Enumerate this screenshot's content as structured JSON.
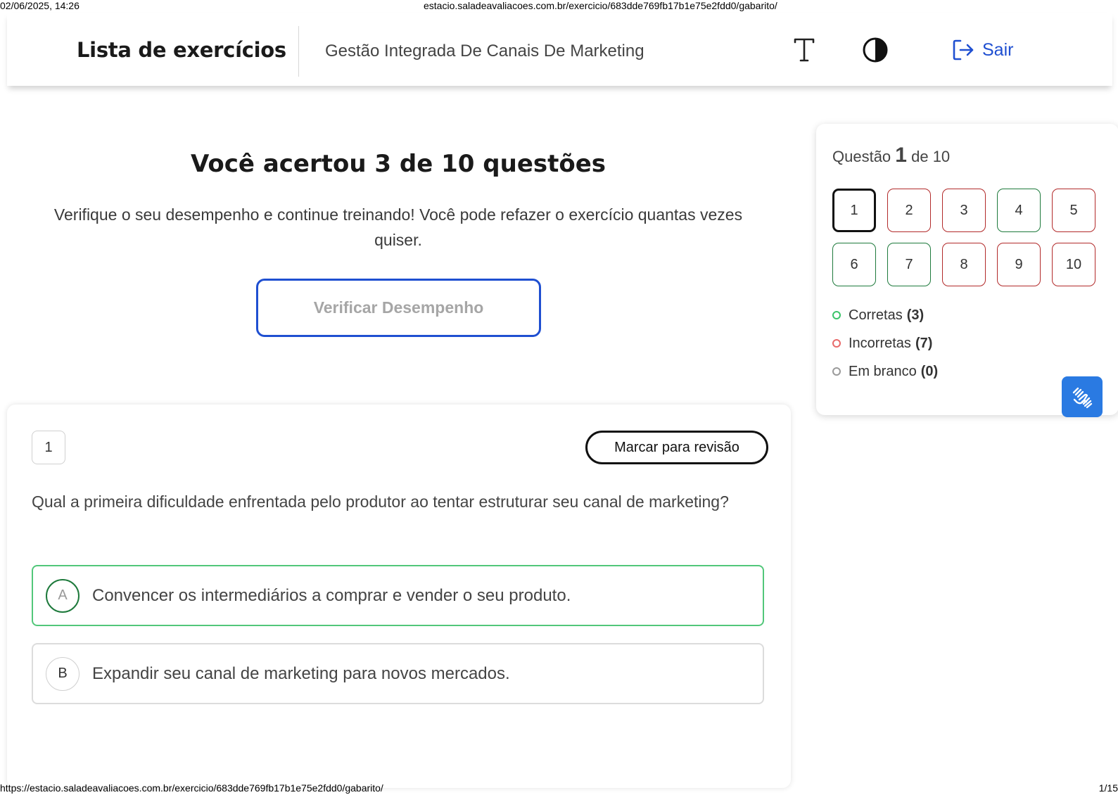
{
  "print": {
    "date": "02/06/2025, 14:26",
    "top_url": "estacio.saladeavaliacoes.com.br/exercicio/683dde769fb17b1e75e2fdd0/gabarito/",
    "bottom_url": "https://estacio.saladeavaliacoes.com.br/exercicio/683dde769fb17b1e75e2fdd0/gabarito/",
    "page": "1/15"
  },
  "header": {
    "title": "Lista de exercícios",
    "course": "Gestão Integrada De Canais De Marketing",
    "font_icon": "font-size-icon",
    "contrast_icon": "contrast-icon",
    "logout_label": "Sair",
    "accent": "#1f4fd1"
  },
  "result": {
    "title": "Você acertou 3 de 10 questões",
    "subtitle": "Verifique o seu desempenho e continue treinando! Você pode refazer o exercício quantas vezes quiser.",
    "button_label": "Verificar Desempenho"
  },
  "question": {
    "number": "1",
    "mark_label": "Marcar para revisão",
    "text": "Qual a primeira dificuldade enfrentada pelo produtor ao tentar estruturar seu canal de marketing?",
    "options": [
      {
        "letter": "A",
        "text": "Convencer os intermediários a comprar e vender o seu produto.",
        "state": "correct"
      },
      {
        "letter": "B",
        "text": "Expandir seu canal de marketing para novos mercados.",
        "state": "neutral"
      }
    ]
  },
  "navigator": {
    "prefix": "Questão",
    "current": "1",
    "suffix": "de 10",
    "cells": [
      {
        "label": "1",
        "status": "current"
      },
      {
        "label": "2",
        "status": "incorrect"
      },
      {
        "label": "3",
        "status": "incorrect"
      },
      {
        "label": "4",
        "status": "correct"
      },
      {
        "label": "5",
        "status": "incorrect"
      },
      {
        "label": "6",
        "status": "correct"
      },
      {
        "label": "7",
        "status": "correct"
      },
      {
        "label": "8",
        "status": "incorrect"
      },
      {
        "label": "9",
        "status": "incorrect"
      },
      {
        "label": "10",
        "status": "incorrect"
      }
    ],
    "legend": [
      {
        "label": "Corretas",
        "count": "(3)",
        "color": "#3cc46a"
      },
      {
        "label": "Incorretas",
        "count": "(7)",
        "color": "#e86a6a"
      },
      {
        "label": "Em branco",
        "count": "(0)",
        "color": "#9a9a9a"
      }
    ],
    "colors": {
      "correct": "#1e7a3c",
      "incorrect": "#b22a2a"
    }
  },
  "libras_icon": "sign-language-hands-icon"
}
